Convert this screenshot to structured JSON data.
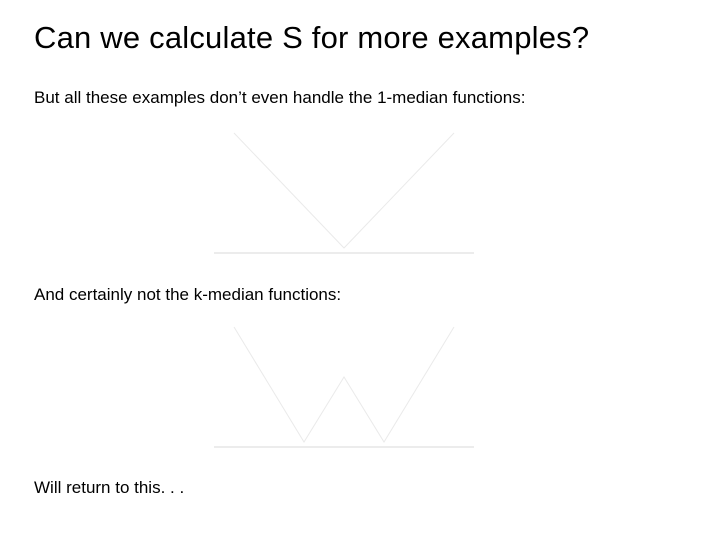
{
  "title": "Can we calculate S for more examples?",
  "body": {
    "line1": "But all these examples don’t even handle the 1-median functions:",
    "line2": "And certainly not the k-median functions:",
    "line3": "Will return to this. . ."
  }
}
